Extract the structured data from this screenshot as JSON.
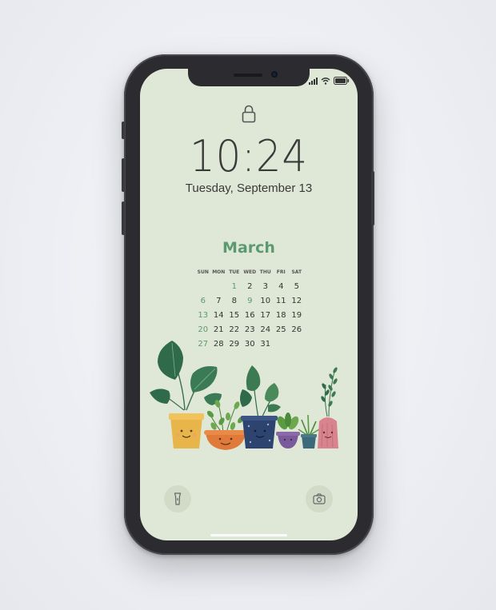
{
  "lock_screen": {
    "time": "10:24",
    "date": "Tuesday, September 13"
  },
  "calendar": {
    "month": "March",
    "weekdays": [
      "SUN",
      "MON",
      "TUE",
      "WED",
      "THU",
      "FRI",
      "SAT"
    ],
    "weeks": [
      [
        "",
        "",
        "1",
        "2",
        "3",
        "4",
        "5"
      ],
      [
        "6",
        "7",
        "8",
        "9",
        "10",
        "11",
        "12"
      ],
      [
        "13",
        "14",
        "15",
        "16",
        "17",
        "18",
        "19"
      ],
      [
        "20",
        "21",
        "22",
        "23",
        "24",
        "25",
        "26"
      ],
      [
        "27",
        "28",
        "29",
        "30",
        "31",
        "",
        ""
      ]
    ],
    "highlighted_days": [
      "1",
      "9"
    ]
  },
  "quick_actions": {
    "left": "flashlight-icon",
    "right": "camera-icon"
  },
  "colors": {
    "wallpaper": "#dfe8d6",
    "accent_green": "#5b9a70",
    "phone_body": "#2c2c30"
  }
}
